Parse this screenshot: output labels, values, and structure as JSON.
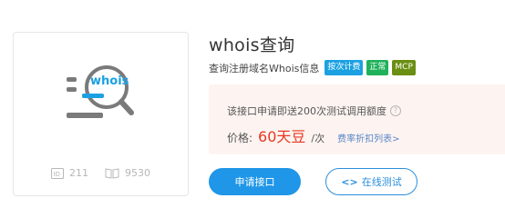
{
  "card": {
    "logo_text": "whois",
    "logo_icon": "magnifier-whois-icon",
    "stats": [
      {
        "icon": "id-icon",
        "value": "211"
      },
      {
        "icon": "book-icon",
        "value": "9530"
      }
    ]
  },
  "header": {
    "title": "whois查询",
    "subtitle": "查询注册域名Whois信息",
    "tags": [
      {
        "label": "按次计费",
        "color": "#1ba1e2"
      },
      {
        "label": "正常",
        "color": "#1fb15b"
      },
      {
        "label": "MCP",
        "color": "#6b8f12"
      }
    ]
  },
  "pricing": {
    "notice": "该接口申请即送200次测试调用额度",
    "help_icon": "question-circle-icon",
    "label": "价格:",
    "value": "60天豆",
    "unit": "/次",
    "discount_link": "费率折扣列表>"
  },
  "actions": {
    "apply_label": "申请接口",
    "test_label": "在线测试",
    "test_icon": "code-brackets-icon"
  },
  "colors": {
    "accent": "#1f96e8",
    "price": "#e8371f",
    "box_bg": "#fdf4f1"
  }
}
